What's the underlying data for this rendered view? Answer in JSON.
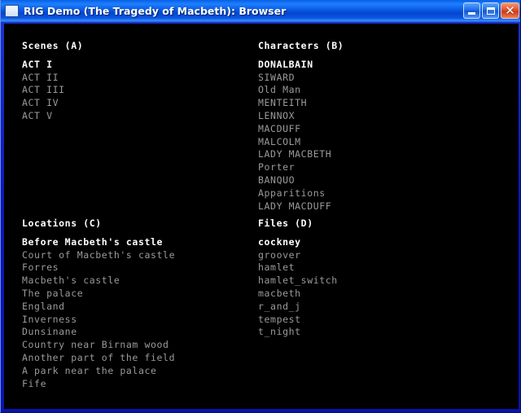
{
  "window": {
    "title": "RIG Demo (The Tragedy of Macbeth): Browser",
    "icon": "window-app-icon",
    "controls": {
      "minimize_label": "_",
      "maximize_label": "□",
      "close_label": "✕"
    },
    "colors": {
      "titlebar_blue": "#0a5ae4",
      "frame_blue": "#0b18b4",
      "canvas_black": "#000000",
      "text_dim": "#9a9a9a",
      "text_selected": "#ffffff",
      "close_button_red": "#cf3a16"
    }
  },
  "panels": {
    "scenes": {
      "title": "Scenes (A)",
      "items": [
        {
          "label": "ACT I",
          "selected": true
        },
        {
          "label": "ACT II",
          "selected": false
        },
        {
          "label": "ACT III",
          "selected": false
        },
        {
          "label": "ACT IV",
          "selected": false
        },
        {
          "label": "ACT V",
          "selected": false
        }
      ]
    },
    "characters": {
      "title": "Characters (B)",
      "items": [
        {
          "label": "DONALBAIN",
          "selected": true
        },
        {
          "label": "SIWARD",
          "selected": false
        },
        {
          "label": "Old Man",
          "selected": false
        },
        {
          "label": "MENTEITH",
          "selected": false
        },
        {
          "label": "LENNOX",
          "selected": false
        },
        {
          "label": "MACDUFF",
          "selected": false
        },
        {
          "label": "MALCOLM",
          "selected": false
        },
        {
          "label": "LADY MACBETH",
          "selected": false
        },
        {
          "label": "Porter",
          "selected": false
        },
        {
          "label": "BANQUO",
          "selected": false
        },
        {
          "label": "Apparitions",
          "selected": false
        },
        {
          "label": "LADY MACDUFF",
          "selected": false
        }
      ]
    },
    "locations": {
      "title": "Locations (C)",
      "items": [
        {
          "label": "Before Macbeth's castle",
          "selected": true
        },
        {
          "label": "Court of Macbeth's castle",
          "selected": false
        },
        {
          "label": "Forres",
          "selected": false
        },
        {
          "label": "Macbeth's castle",
          "selected": false
        },
        {
          "label": "The palace",
          "selected": false
        },
        {
          "label": "England",
          "selected": false
        },
        {
          "label": "Inverness",
          "selected": false
        },
        {
          "label": "Dunsinane",
          "selected": false
        },
        {
          "label": "Country near Birnam wood",
          "selected": false
        },
        {
          "label": "Another part of the field",
          "selected": false
        },
        {
          "label": "A park near the palace",
          "selected": false
        },
        {
          "label": "Fife",
          "selected": false
        }
      ]
    },
    "files": {
      "title": "Files (D)",
      "items": [
        {
          "label": "cockney",
          "selected": true
        },
        {
          "label": "groover",
          "selected": false
        },
        {
          "label": "hamlet",
          "selected": false
        },
        {
          "label": "hamlet_switch",
          "selected": false
        },
        {
          "label": "macbeth",
          "selected": false
        },
        {
          "label": "r_and_j",
          "selected": false
        },
        {
          "label": "tempest",
          "selected": false
        },
        {
          "label": "t_night",
          "selected": false
        }
      ]
    }
  }
}
